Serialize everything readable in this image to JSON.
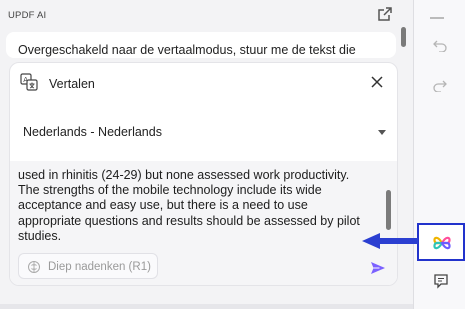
{
  "panel": {
    "title": "UPDF AI",
    "chat_message": "Overgeschakeld naar de vertaalmodus, stuur me de tekst die"
  },
  "translate_card": {
    "title": "Vertalen",
    "language": "Nederlands - Nederlands",
    "input_text": "used in rhinitis (24-29) but none assessed work productivity.\nThe strengths of the mobile technology include its wide acceptance and easy use, but there is a need to use appropriate questions and results should be assessed by pilot studies.",
    "think_button": "Diep nadenken (R1)"
  },
  "icons": {
    "popout": "popout-icon",
    "translate": "translate-icon",
    "close": "close-icon",
    "send": "send-icon",
    "think": "brain-icon",
    "undo": "undo-icon",
    "redo": "redo-icon",
    "ai": "updf-ai-logo-icon",
    "comment": "comment-icon"
  },
  "colors": {
    "highlight_border": "#2233cc",
    "arrow": "#2b3fd1",
    "send": "#7b61ff"
  }
}
